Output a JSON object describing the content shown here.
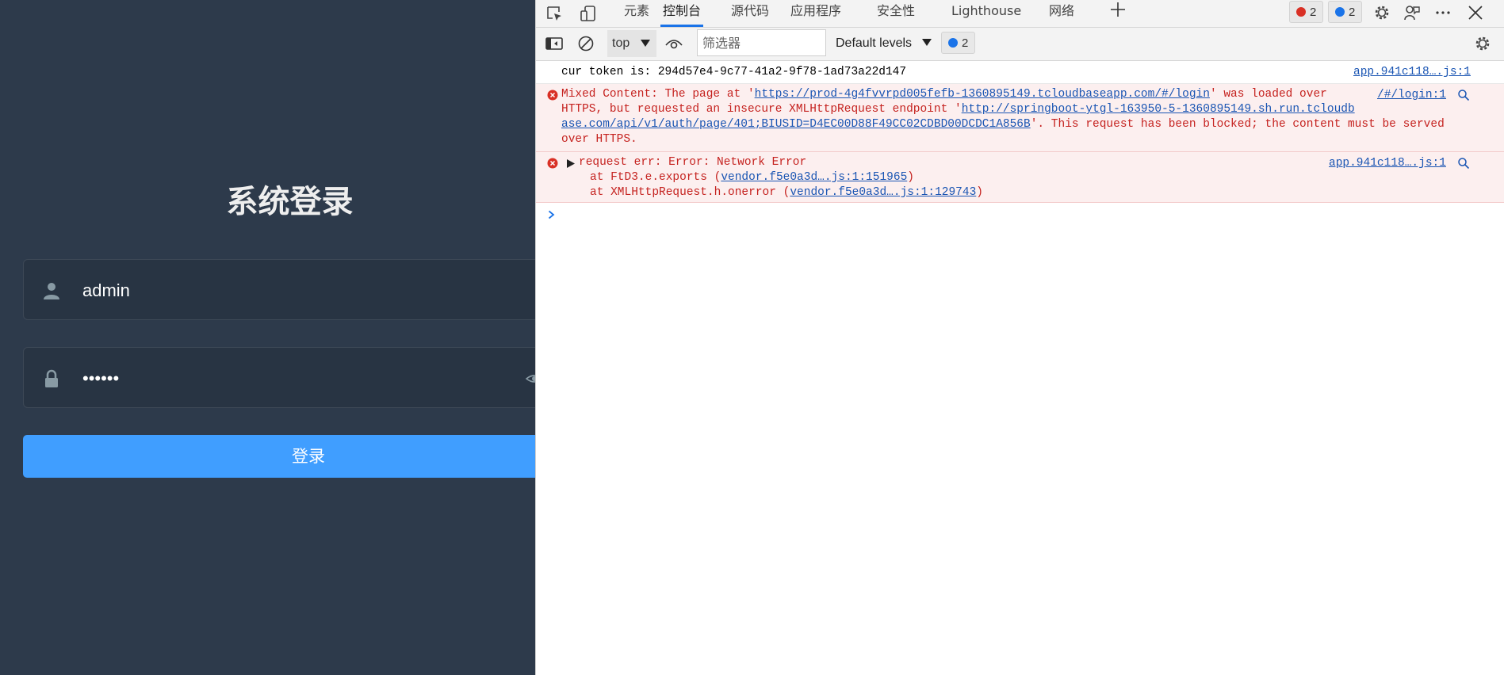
{
  "login": {
    "title": "系统登录",
    "username_value": "admin",
    "password_value": "••••••",
    "submit_label": "登录"
  },
  "devtools": {
    "tabs": [
      {
        "label": "元素"
      },
      {
        "label": "控制台",
        "active": true
      },
      {
        "label": "源代码"
      },
      {
        "label": "应用程序"
      },
      {
        "label": "安全性"
      },
      {
        "label": "Lighthouse"
      },
      {
        "label": "网络"
      }
    ],
    "error_count": "2",
    "message_count": "2",
    "toolbar": {
      "context": "top",
      "filter_placeholder": "筛选器",
      "levels": "Default levels",
      "issues_count": "2"
    },
    "console": {
      "log1": {
        "text": "cur token is: 294d57e4-9c77-41a2-9f78-1ad73a22d147",
        "source": "app.941c118….js:1"
      },
      "error1": {
        "p1": "Mixed Content: The page at '",
        "url1": "https://prod-4g4fvvrpd005fefb-1360895149.tcloudbaseapp.com/#/login",
        "p2": "' was loaded over",
        "p3": "HTTPS, but requested an insecure XMLHttpRequest endpoint '",
        "url2a": "http://springboot-ytgl-163950-5-1360895149.sh.run.tcloudb",
        "url2b": "ase.com/api/v1/auth/page/401;BIUSID=D4EC00D88F49CC02CDBD00DCDC1A856B",
        "p4": "'. This request has been blocked; the content must be served",
        "p5": "over HTTPS.",
        "source": "/#/login:1"
      },
      "error2": {
        "head": "request err: Error: Network Error",
        "at1": "at FtD3.e.exports (",
        "at1_link": "vendor.f5e0a3d….js:1:151965",
        "at1_end": ")",
        "at2": "at XMLHttpRequest.h.onerror (",
        "at2_link": "vendor.f5e0a3d….js:1:129743",
        "at2_end": ")",
        "source": "app.941c118….js:1"
      }
    }
  }
}
